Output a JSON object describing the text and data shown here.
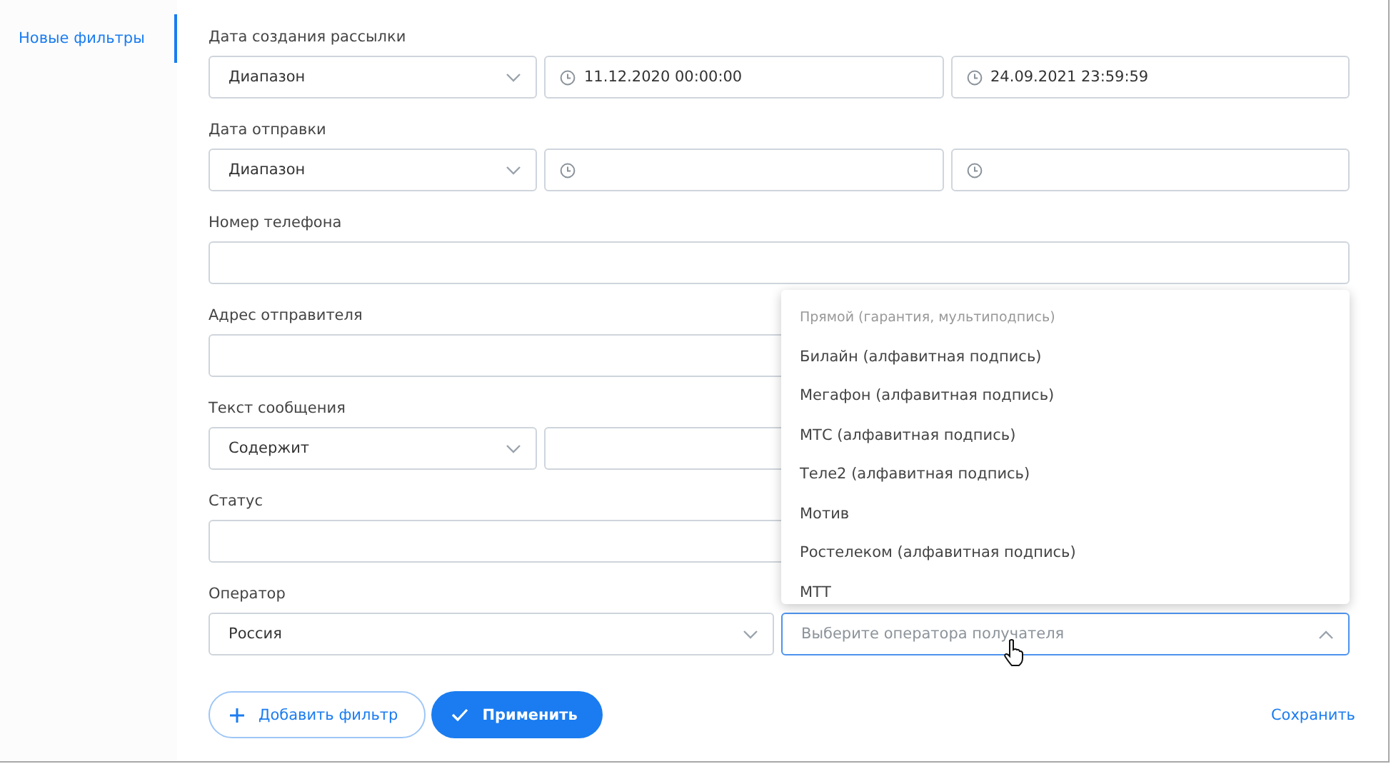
{
  "sidebar": {
    "items": [
      {
        "label": "Новые фильтры",
        "selected": true
      }
    ]
  },
  "filters": [
    {
      "kind": "range",
      "label": "Дата создания рассылки",
      "select": "Диапазон",
      "from": "11.12.2020 00:00:00",
      "to": "24.09.2021 23:59:59"
    },
    {
      "kind": "range",
      "label": "Дата отправки",
      "select": "Диапазон"
    },
    {
      "kind": "text",
      "label": "Номер телефона"
    },
    {
      "kind": "text",
      "label": "Адрес отправителя"
    },
    {
      "kind": "select_text",
      "label": "Текст сообщения",
      "select": "Содержит"
    },
    {
      "kind": "text",
      "label": "Статус"
    },
    {
      "kind": "two_selects",
      "label": "Оператор",
      "select": "Россия",
      "second": {
        "placeholder": "Выберите оператора получателя",
        "expanded": true,
        "options": [
          {
            "kind": "header",
            "label": "Прямой (гарантия, мультиподпись)"
          },
          {
            "kind": "option",
            "label": "Билайн (алфавитная подпись)"
          },
          {
            "kind": "option",
            "label": "Мегафон (алфавитная подпись)"
          },
          {
            "kind": "option",
            "label": "МТС (алфавитная подпись)"
          },
          {
            "kind": "option",
            "label": "Теле2 (алфавитная подпись)"
          },
          {
            "kind": "option",
            "label": "Мотив"
          },
          {
            "kind": "option",
            "label": "Ростелеком (алфавитная подпись)"
          },
          {
            "kind": "option",
            "label": "МТТ"
          }
        ]
      }
    }
  ],
  "actions": {
    "add_filter": "Добавить фильтр",
    "apply": "Применить",
    "save": "Сохранить"
  }
}
